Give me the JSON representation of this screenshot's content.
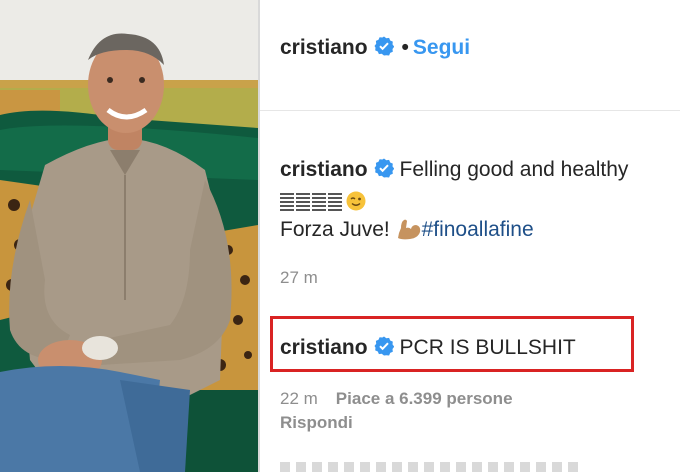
{
  "photo": {
    "subject": "man seated on green velvet sofa with leopard-print cushions"
  },
  "header": {
    "username": "cristiano",
    "separator": "•",
    "follow_label": "Segui"
  },
  "caption": {
    "username": "cristiano",
    "text_line1": "Felling good and healthy",
    "text_line2_prefix": "Forza Juve!",
    "hashtag": "#finoallafine"
  },
  "caption_time": "27 m",
  "comment": {
    "username": "cristiano",
    "text": "PCR IS BULLSHIT",
    "time": "22 m",
    "likes": "Piace a 6.399 persone",
    "reply_label": "Rispondi"
  },
  "colors": {
    "follow": "#3897f0",
    "verified": "#3897f0",
    "highlight_box": "#d92323",
    "meta": "#8e8e8e",
    "hashtag": "#1e4f88"
  },
  "icons": [
    "verified-badge-icon",
    "wink-emoji-icon",
    "flexed-biceps-emoji-icon"
  ]
}
